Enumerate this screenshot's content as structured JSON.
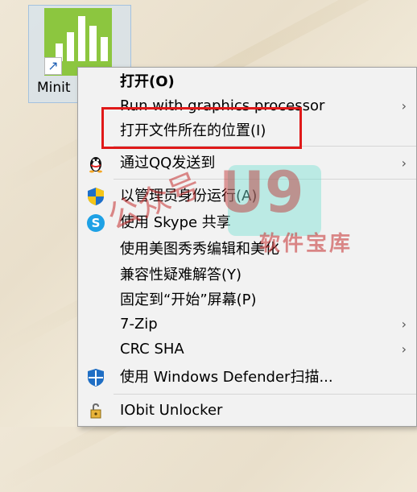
{
  "desktop": {
    "icon_label": "Minit",
    "shortcut_glyph": "↗"
  },
  "menu": {
    "items": [
      {
        "label": "打开(O)",
        "bold": true,
        "icon": null,
        "submenu": false
      },
      {
        "label": "Run with graphics processor",
        "bold": false,
        "icon": null,
        "submenu": true
      },
      {
        "label": "打开文件所在的位置(I)",
        "bold": false,
        "icon": null,
        "submenu": false
      },
      {
        "label": "通过QQ发送到",
        "bold": false,
        "icon": "qq-penguin-icon",
        "submenu": true
      },
      {
        "label": "以管理员身份运行(A)",
        "bold": false,
        "icon": "uac-shield-icon",
        "submenu": false
      },
      {
        "label": "使用 Skype 共享",
        "bold": false,
        "icon": "skype-icon",
        "submenu": false
      },
      {
        "label": "使用美图秀秀编辑和美化",
        "bold": false,
        "icon": null,
        "submenu": false
      },
      {
        "label": "兼容性疑难解答(Y)",
        "bold": false,
        "icon": null,
        "submenu": false
      },
      {
        "label": "固定到“开始”屏幕(P)",
        "bold": false,
        "icon": null,
        "submenu": false
      },
      {
        "label": "7-Zip",
        "bold": false,
        "icon": null,
        "submenu": true
      },
      {
        "label": "CRC SHA",
        "bold": false,
        "icon": null,
        "submenu": true
      },
      {
        "label": "使用 Windows Defender扫描...",
        "bold": false,
        "icon": "defender-shield-icon",
        "submenu": false
      },
      {
        "label": "IObit Unlocker",
        "bold": false,
        "icon": "unlocker-icon",
        "submenu": false
      }
    ],
    "submenu_arrow": "›"
  },
  "watermark": {
    "text": "公众号",
    "logo_text": "U9",
    "sub_text": "软件宝库"
  },
  "colors": {
    "highlight_border": "#e01919",
    "app_tile": "#8cc63f",
    "menu_bg": "#f2f2f2"
  }
}
